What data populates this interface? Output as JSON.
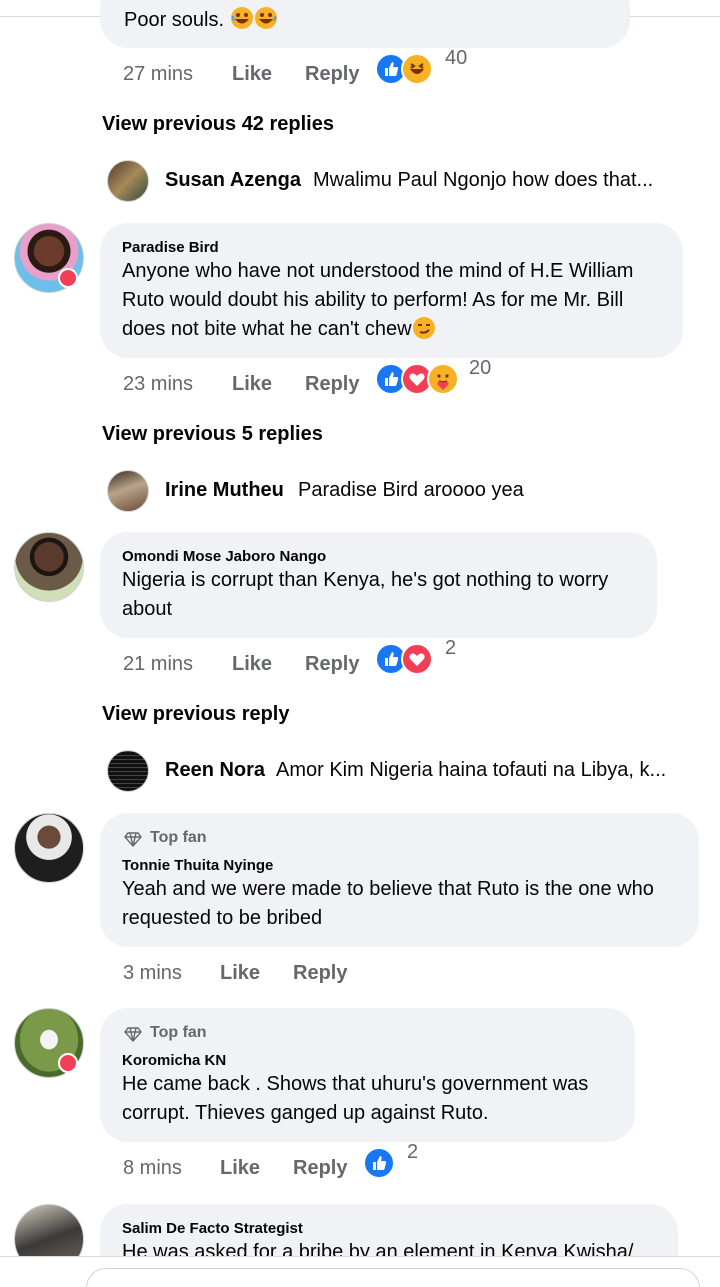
{
  "top_comment": {
    "text_tail": "Poor souls.",
    "time": "27 mins",
    "like": "Like",
    "reply": "Reply",
    "reaction_icons": [
      "like-icon",
      "haha-icon"
    ],
    "reaction_count": "40"
  },
  "view_prev_1": "View previous 42 replies",
  "reply_1": {
    "name": "Susan Azenga",
    "snippet": "Mwalimu Paul Ngonjo  how does that..."
  },
  "comment_1": {
    "author": "Paradise Bird",
    "line1": "Anyone who have not understood the mind of H.E William",
    "line2": "Ruto would doubt his ability to perform! As for me Mr. Bill",
    "line3": "does not bite what he can't chew",
    "time": "23 mins",
    "like": "Like",
    "reply": "Reply",
    "reaction_icons": [
      "like-icon",
      "love-icon",
      "care-icon"
    ],
    "reaction_count": "20"
  },
  "view_prev_2": "View previous 5 replies",
  "reply_2": {
    "name": "Irine Mutheu",
    "snippet": "Paradise Bird aroooo yea"
  },
  "comment_2": {
    "author": "Omondi Mose Jaboro Nango",
    "line1": "Nigeria is corrupt than Kenya, he's got nothing to worry",
    "line2": "about",
    "time": "21 mins",
    "like": "Like",
    "reply": "Reply",
    "reaction_icons": [
      "like-icon",
      "love-icon"
    ],
    "reaction_count": "2"
  },
  "view_prev_3": "View previous reply",
  "reply_3": {
    "name": "Reen Nora",
    "snippet": "Amor Kim Nigeria haina tofauti na Libya, k..."
  },
  "comment_3": {
    "badge": "Top fan",
    "author": "Tonnie Thuita Nyinge",
    "line1": "Yeah and we were made to believe that Ruto is the one who",
    "line2": "requested to be bribed",
    "time": "3 mins",
    "like": "Like",
    "reply": "Reply"
  },
  "comment_4": {
    "badge": "Top fan",
    "author": "Koromicha KN",
    "line1": "He came back . Shows that uhuru's government was",
    "line2": "corrupt. Thieves ganged up against Ruto.",
    "time": "8 mins",
    "like": "Like",
    "reply": "Reply",
    "reaction_icons": [
      "like-icon"
    ],
    "reaction_count": "2"
  },
  "comment_5": {
    "author": "Salim De Facto Strategist",
    "line1": "He was asked for a bribe by an element in Kenya Kwisha/"
  },
  "colors": {
    "like_blue": "#1877f2",
    "love_red": "#f33e58",
    "haha_yellow": "#f7b125",
    "meta_gray": "#65676b",
    "bubble_bg": "#f0f2f5"
  }
}
